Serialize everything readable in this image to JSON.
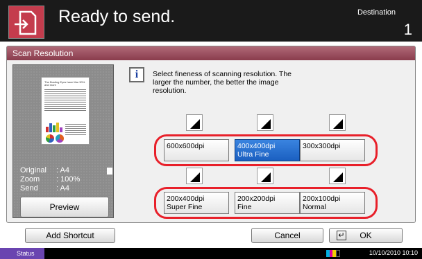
{
  "header": {
    "title": "Ready to send.",
    "destination_label": "Destination",
    "destination_count": "1",
    "icon": "send-document-icon"
  },
  "panel": {
    "title": "Scan Resolution"
  },
  "preview": {
    "doc_heading": "The Busting Eyes have Mar 30% and more",
    "original_label": "Original",
    "original_value": ": A4",
    "zoom_label": "Zoom",
    "zoom_value": ": 100%",
    "send_label": "Send",
    "send_value": ": A4",
    "preview_button": "Preview",
    "orientation_icon": "portrait-orientation-icon"
  },
  "info": {
    "icon": "info-icon",
    "text": "Select fineness of scanning resolution. The larger the number, the better the image resolution."
  },
  "resolutions": {
    "top_row": [
      {
        "line1": "600x600dpi",
        "line2": "",
        "selected": false
      },
      {
        "line1": "400x400dpi",
        "line2": "Ultra Fine",
        "selected": true
      },
      {
        "line1": "300x300dpi",
        "line2": "",
        "selected": false
      }
    ],
    "bottom_row": [
      {
        "line1": "200x400dpi",
        "line2": "Super Fine",
        "selected": false
      },
      {
        "line1": "200x200dpi",
        "line2": "Fine",
        "selected": false
      },
      {
        "line1": "200x100dpi",
        "line2": "Normal",
        "selected": false
      }
    ]
  },
  "footer": {
    "add_shortcut": "Add Shortcut",
    "cancel": "Cancel",
    "ok": "OK"
  },
  "statusbar": {
    "status": "Status",
    "datetime": "10/10/2010  10:10"
  },
  "colors": {
    "accent": "#c43c4d",
    "selected": "#1a5fc0",
    "highlight": "#e8202a",
    "status": "#6a44b0"
  }
}
